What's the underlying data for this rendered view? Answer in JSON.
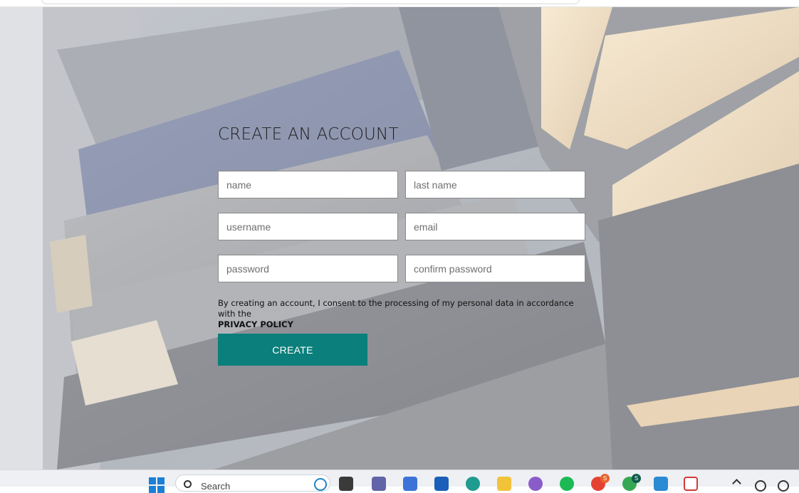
{
  "form": {
    "title": "CREATE AN ACCOUNT",
    "fields": {
      "name": {
        "placeholder": "name",
        "value": ""
      },
      "last_name": {
        "placeholder": "last name",
        "value": ""
      },
      "username": {
        "placeholder": "username",
        "value": ""
      },
      "email": {
        "placeholder": "email",
        "value": ""
      },
      "password": {
        "placeholder": "password",
        "value": ""
      },
      "confirm_password": {
        "placeholder": "confirm password",
        "value": ""
      }
    },
    "consent_text": "By creating an account, I consent to the processing of my personal data in accordance with the",
    "privacy_link": "PRIVACY POLICY",
    "submit_label": "CREATE",
    "accent_color": "#0a7f7b"
  },
  "taskbar": {
    "search_label": "Search",
    "icons": [
      "windows-start-icon",
      "search-icon",
      "bing-icon",
      "task-view-icon",
      "teams-icon",
      "copilot-icon",
      "mail-icon",
      "edge-icon",
      "file-explorer-icon",
      "podcast-icon",
      "spotify-icon",
      "chrome-icon",
      "chrome-profile-icon",
      "vscode-icon",
      "snipping-tool-icon",
      "tray-chevron-icon",
      "network-icon",
      "wifi-icon"
    ],
    "chrome_badge": "S",
    "chrome_profile_badge": "S"
  }
}
